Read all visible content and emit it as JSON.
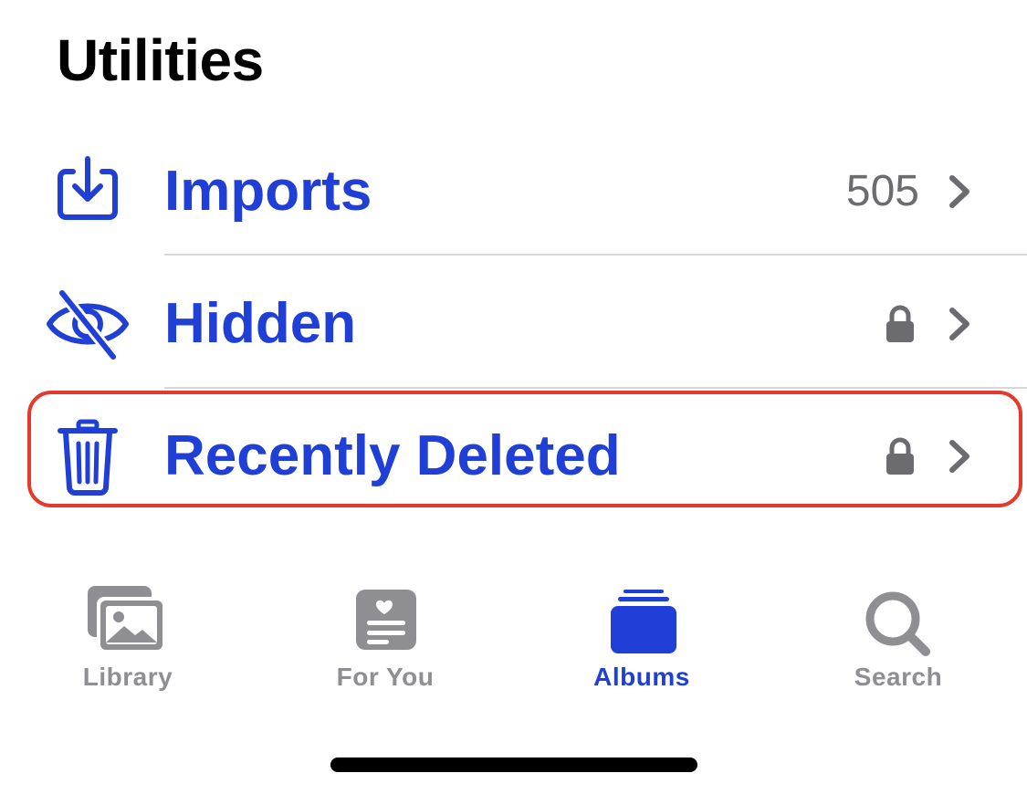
{
  "section": {
    "title": "Utilities"
  },
  "rows": [
    {
      "label": "Imports",
      "count": "505",
      "icon": "import-tray-icon",
      "locked": false
    },
    {
      "label": "Hidden",
      "icon": "eye-slash-icon",
      "locked": true
    },
    {
      "label": "Recently Deleted",
      "icon": "trash-icon",
      "locked": true,
      "highlighted": true
    }
  ],
  "tabs": [
    {
      "label": "Library",
      "icon": "photo-stack-icon",
      "active": false
    },
    {
      "label": "For You",
      "icon": "heart-card-icon",
      "active": false
    },
    {
      "label": "Albums",
      "icon": "albums-stack-icon",
      "active": true
    },
    {
      "label": "Search",
      "icon": "magnifying-glass-icon",
      "active": false
    }
  ],
  "colors": {
    "accent": "#1f3fd6",
    "secondary_text": "#6b6b70",
    "inactive_tab": "#8e8e93",
    "highlight_border": "#e33a2b",
    "divider": "#d8d8dc"
  }
}
